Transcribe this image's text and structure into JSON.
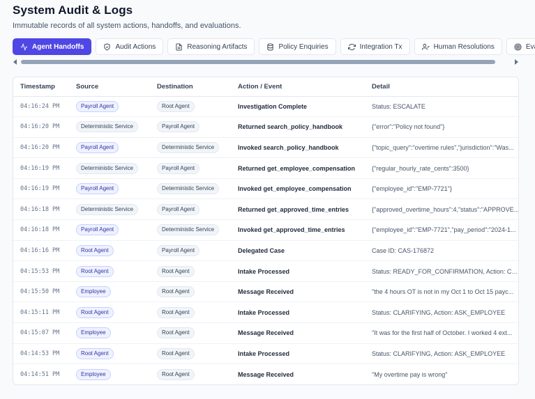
{
  "header": {
    "title": "System Audit & Logs",
    "subtitle": "Immutable records of all system actions, handoffs, and evaluations."
  },
  "tabs": [
    {
      "label": "Agent Handoffs",
      "icon": "activity-icon",
      "active": true
    },
    {
      "label": "Audit Actions",
      "icon": "shield-icon",
      "active": false
    },
    {
      "label": "Reasoning Artifacts",
      "icon": "file-text-icon",
      "active": false
    },
    {
      "label": "Policy Enquiries",
      "icon": "database-icon",
      "active": false
    },
    {
      "label": "Integration Tx",
      "icon": "refresh-icon",
      "active": false
    },
    {
      "label": "Human Resolutions",
      "icon": "user-check-icon",
      "active": false
    },
    {
      "label": "Evaluation Resu",
      "icon": "target-icon",
      "active": false
    }
  ],
  "table": {
    "columns": [
      "Timestamp",
      "Source",
      "Destination",
      "Action / Event",
      "Detail"
    ],
    "rows": [
      {
        "timestamp": "04:16:24 PM",
        "source": "Payroll Agent",
        "destination": "Root Agent",
        "action": "Investigation Complete",
        "detail": "Status: ESCALATE"
      },
      {
        "timestamp": "04:16:20 PM",
        "source": "Deterministic Service",
        "destination": "Payroll Agent",
        "action": "Returned search_policy_handbook",
        "detail": "{\"error\":\"Policy not found\"}"
      },
      {
        "timestamp": "04:16:20 PM",
        "source": "Payroll Agent",
        "destination": "Deterministic Service",
        "action": "Invoked search_policy_handbook",
        "detail": "{\"topic_query\":\"overtime rules\",\"jurisdiction\":\"Was..."
      },
      {
        "timestamp": "04:16:19 PM",
        "source": "Deterministic Service",
        "destination": "Payroll Agent",
        "action": "Returned get_employee_compensation",
        "detail": "{\"regular_hourly_rate_cents\":3500}"
      },
      {
        "timestamp": "04:16:19 PM",
        "source": "Payroll Agent",
        "destination": "Deterministic Service",
        "action": "Invoked get_employee_compensation",
        "detail": "{\"employee_id\":\"EMP-7721\"}"
      },
      {
        "timestamp": "04:16:18 PM",
        "source": "Deterministic Service",
        "destination": "Payroll Agent",
        "action": "Returned get_approved_time_entries",
        "detail": "{\"approved_overtime_hours\":4,\"status\":\"APPROVE..."
      },
      {
        "timestamp": "04:16:18 PM",
        "source": "Payroll Agent",
        "destination": "Deterministic Service",
        "action": "Invoked get_approved_time_entries",
        "detail": "{\"employee_id\":\"EMP-7721\",\"pay_period\":\"2024-1..."
      },
      {
        "timestamp": "04:16:16 PM",
        "source": "Root Agent",
        "destination": "Payroll Agent",
        "action": "Delegated Case",
        "detail": "Case ID: CAS-176872"
      },
      {
        "timestamp": "04:15:53 PM",
        "source": "Root Agent",
        "destination": "Root Agent",
        "action": "Intake Processed",
        "detail": "Status: READY_FOR_CONFIRMATION, Action: CO..."
      },
      {
        "timestamp": "04:15:50 PM",
        "source": "Employee",
        "destination": "Root Agent",
        "action": "Message Received",
        "detail": "\"the 4 hours OT is not in my Oct 1 to Oct 15 payc..."
      },
      {
        "timestamp": "04:15:11 PM",
        "source": "Root Agent",
        "destination": "Root Agent",
        "action": "Intake Processed",
        "detail": "Status: CLARIFYING, Action: ASK_EMPLOYEE"
      },
      {
        "timestamp": "04:15:07 PM",
        "source": "Employee",
        "destination": "Root Agent",
        "action": "Message Received",
        "detail": "\"It was for the first half of October. I worked 4 ext..."
      },
      {
        "timestamp": "04:14:53 PM",
        "source": "Root Agent",
        "destination": "Root Agent",
        "action": "Intake Processed",
        "detail": "Status: CLARIFYING, Action: ASK_EMPLOYEE"
      },
      {
        "timestamp": "04:14:51 PM",
        "source": "Employee",
        "destination": "Root Agent",
        "action": "Message Received",
        "detail": "\"My overtime pay is wrong\""
      }
    ]
  },
  "colors": {
    "accent": "#4f46e5",
    "background": "#f8fafc",
    "badge_agent_bg": "#eef2ff",
    "badge_agent_text": "#3730a3"
  }
}
